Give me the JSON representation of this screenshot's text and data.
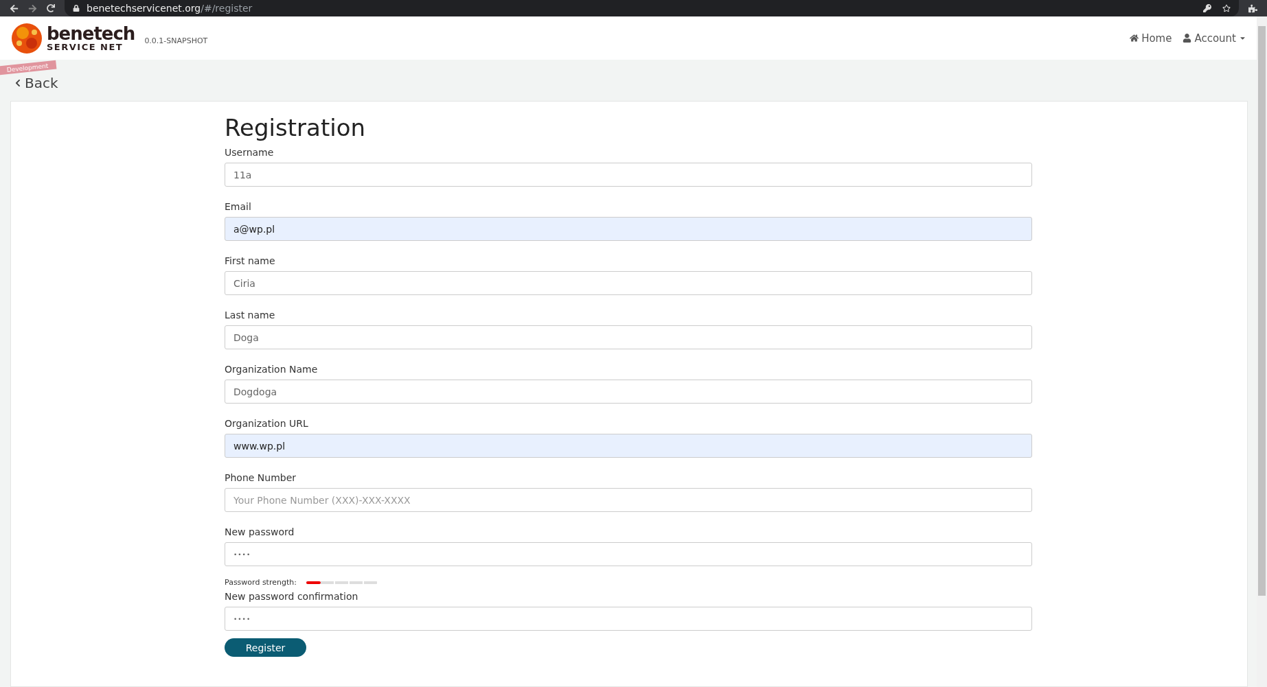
{
  "browser": {
    "url_host": "benetechservicenet.org",
    "url_path": "/#/register"
  },
  "header": {
    "brand_top": "benetech",
    "brand_bottom": "SERVICE NET",
    "version": "0.0.1-SNAPSHOT",
    "ribbon": "Development",
    "nav": [
      {
        "label": "Home",
        "kind": "home"
      },
      {
        "label": "Account",
        "kind": "account"
      }
    ]
  },
  "back": "Back",
  "title": "Registration",
  "fields": [
    {
      "label": "Username",
      "value": "11a",
      "autofilled": false
    },
    {
      "label": "Email",
      "value": "a@wp.pl",
      "autofilled": true
    },
    {
      "label": "First name",
      "value": "Ciria",
      "autofilled": false
    },
    {
      "label": "Last name",
      "value": "Doga",
      "autofilled": false
    },
    {
      "label": "Organization Name",
      "value": "Dogdoga",
      "autofilled": false
    },
    {
      "label": "Organization URL",
      "value": "www.wp.pl",
      "autofilled": true
    },
    {
      "label": "Phone Number",
      "placeholder": "Your Phone Number (XXX)-XXX-XXXX",
      "autofilled": false
    },
    {
      "label": "New password",
      "value": "••••",
      "autofilled": false,
      "kind": "password"
    }
  ],
  "strength": {
    "label": "Password strength:",
    "level": 0.2
  },
  "confirm": {
    "label": "New password confirmation",
    "value": "••••"
  },
  "submit": "Register"
}
